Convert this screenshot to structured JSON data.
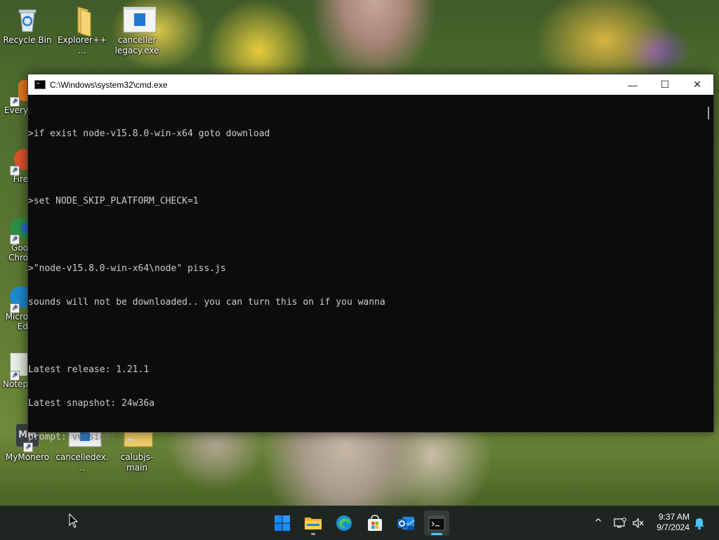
{
  "desktop": {
    "icons_top": [
      {
        "name": "recycle-bin",
        "label": "Recycle Bin",
        "icon": "recycle-bin-icon"
      },
      {
        "name": "explorer-plus",
        "label": "Explorer++ ...",
        "icon": "folder-icon"
      },
      {
        "name": "canceller-legacy",
        "label": "canceller legacy.exe",
        "icon": "exe-icon"
      }
    ],
    "icons_side": [
      {
        "name": "everything",
        "label": "Every",
        "icon": "everything-icon"
      },
      {
        "name": "firefox",
        "label": "Fire",
        "icon": "firefox-icon"
      },
      {
        "name": "google-chrome",
        "label": "Goo Chro",
        "icon": "chrome-icon"
      },
      {
        "name": "microsoft-edge",
        "label": "Micro Ed",
        "icon": "edge-icon"
      },
      {
        "name": "notepad",
        "label": "Notep",
        "icon": "notepad-icon"
      }
    ],
    "icons_bottom": [
      {
        "name": "mymonero",
        "label": "MyMonero",
        "icon": "mymonero-icon",
        "glyph": "MM"
      },
      {
        "name": "cancelledex",
        "label": "cancelledex...",
        "icon": "exe-icon"
      },
      {
        "name": "calubjs-main",
        "label": "calubjs-main",
        "icon": "folder-icon"
      }
    ]
  },
  "cmd": {
    "title": "C:\\Windows\\system32\\cmd.exe",
    "controls": {
      "minimize": "—",
      "maximize": "☐",
      "close": "✕"
    },
    "lines": [
      ">if exist node-v15.8.0-win-x64 goto download",
      "",
      ">set NODE_SKIP_PLATFORM_CHECK=1",
      "",
      ">\"node-v15.8.0-win-x64\\node\" piss.js",
      "sounds will not be downloaded.. you can turn this on if you wanna",
      "",
      "Latest release: 1.21.1",
      "Latest snapshot: 24w36a"
    ],
    "prompt_label": "prompt: ",
    "prompt_hint": "version:"
  },
  "taskbar": {
    "apps": [
      {
        "name": "start",
        "icon": "windows-start-icon"
      },
      {
        "name": "file-explorer",
        "icon": "file-explorer-icon"
      },
      {
        "name": "edge",
        "icon": "edge-icon"
      },
      {
        "name": "microsoft-store",
        "icon": "store-icon"
      },
      {
        "name": "outlook",
        "icon": "outlook-icon"
      },
      {
        "name": "terminal",
        "icon": "terminal-icon",
        "active": true
      }
    ],
    "tray": {
      "chevron": "^",
      "time": "9:37 AM",
      "date": "9/7/2024"
    },
    "colors": {
      "accent": "#4cc2ff",
      "windows_blue": "#1a8cff",
      "taskbar_bg": "#1f2622"
    }
  }
}
